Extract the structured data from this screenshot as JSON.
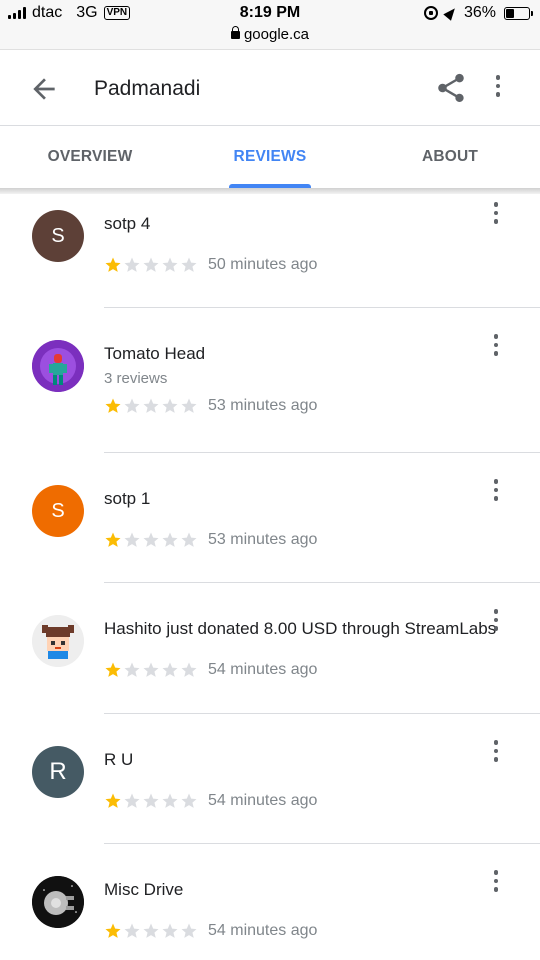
{
  "status": {
    "carrier": "dtac",
    "network": "3G",
    "vpn": "VPN",
    "time": "8:19 PM",
    "url": "google.ca",
    "battery": "36%",
    "battery_level": 0.36
  },
  "header": {
    "title": "Padmanadi"
  },
  "tabs": [
    {
      "label": "OVERVIEW"
    },
    {
      "label": "REVIEWS"
    },
    {
      "label": "ABOUT"
    }
  ],
  "reviews": [
    {
      "name": "sotp 4",
      "avatar_letter": "S",
      "avatar_color": "#5d4037",
      "rating": 1,
      "time": "50 minutes ago"
    },
    {
      "name": "Tomato Head",
      "sub": "3 reviews",
      "avatar_color": "#7b2fbe",
      "rating": 1,
      "time": "53 minutes ago"
    },
    {
      "name": "sotp 1",
      "avatar_letter": "S",
      "avatar_color": "#ef6c00",
      "rating": 1,
      "time": "53 minutes ago"
    },
    {
      "name": "Hashito just donated 8.00 USD through StreamLabs",
      "avatar_color": "#eeeeee",
      "rating": 1,
      "time": "54 minutes ago"
    },
    {
      "name": "R U",
      "avatar_letter": "R",
      "avatar_color": "#455a64",
      "rating": 1,
      "time": "54 minutes ago"
    },
    {
      "name": "Misc Drive",
      "avatar_color": "#111111",
      "rating": 1,
      "time": "54 minutes ago"
    }
  ],
  "colors": {
    "accent": "#4285f4",
    "star_filled": "#fbbc04",
    "star_empty": "#dadce0"
  }
}
